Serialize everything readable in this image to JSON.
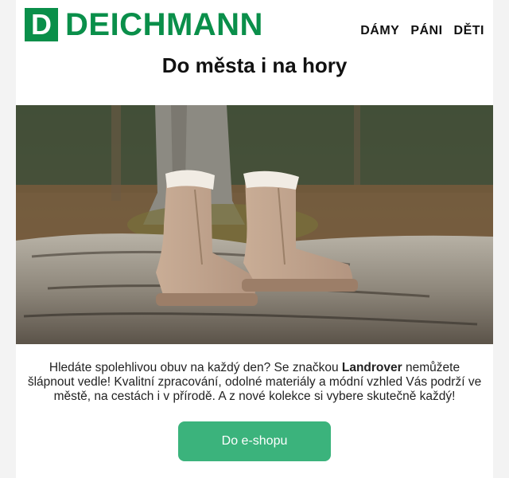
{
  "brand": {
    "logo_letter": "D",
    "name": "DEICHMANN",
    "color": "#0a8f4a"
  },
  "nav": [
    {
      "label": "DÁMY"
    },
    {
      "label": "PÁNI"
    },
    {
      "label": "DĚTI"
    }
  ],
  "headline": "Do města i na hory",
  "hero": {
    "alt": "boots-on-log-photo"
  },
  "body": {
    "part1": "Hledáte spolehlivou obuv na každý den? Se značkou ",
    "brand_bold": "Landrover",
    "part2": " nemůžete šlápnout vedle! Kvalitní zpracování, odolné materiály a módní vzhled Vás podrží ve městě, na cestách i v přírodě. A z nové kolekce si vybere skutečně každý!"
  },
  "cta": {
    "label": "Do e-shopu",
    "color": "#3bb37c"
  }
}
